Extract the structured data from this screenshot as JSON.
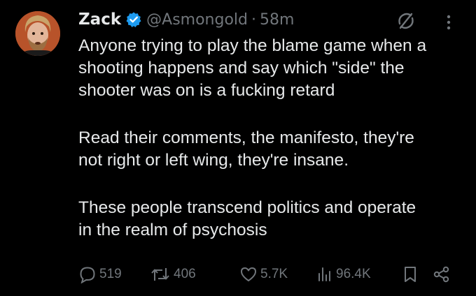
{
  "author": {
    "name": "Zack",
    "handle": "@Asmongold",
    "separator": "·",
    "time": "58m",
    "verified": true,
    "verified_color": "#1d9bf0"
  },
  "tweet": {
    "paragraphs": [
      {
        "lines": [
          "Anyone trying to play the blame game when a",
          "shooting happens and say which \"side\" the",
          "shooter was on is a fucking retard"
        ]
      },
      {
        "lines": [
          "Read their comments, the manifesto, they're",
          "not right or left wing, they're insane."
        ]
      },
      {
        "lines": [
          "These people transcend politics and operate",
          "in the realm of psychosis"
        ]
      }
    ]
  },
  "actions": {
    "reply_count": "519",
    "repost_count": "406",
    "like_count": "5.7K",
    "view_count": "96.4K"
  },
  "icons": {
    "reply": "reply-icon",
    "repost": "repost-icon",
    "like": "heart-icon",
    "views": "views-icon",
    "bookmark": "bookmark-icon",
    "share": "share-icon",
    "grok": "grok-icon",
    "more": "more-icon"
  },
  "colors": {
    "background": "#000000",
    "text": "#e7e9ea",
    "muted": "#71767b",
    "accent": "#1d9bf0"
  }
}
